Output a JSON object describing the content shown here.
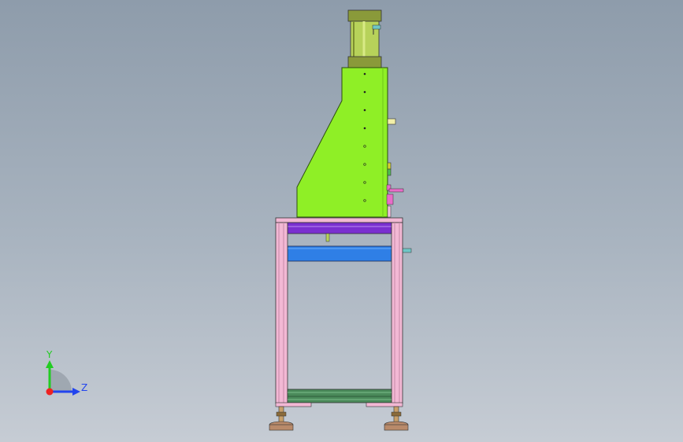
{
  "viewport": {
    "background_top": "#8e9cab",
    "background_bottom": "#c6ccd4"
  },
  "model": {
    "view": "side",
    "colors": {
      "cylinder": "#b7d25a",
      "body": "#8fef26",
      "frame": "#f2b8d4",
      "blue_plate": "#2f7fe6",
      "purple_plate": "#7a2fd0",
      "shelf": "#4a8a5a",
      "feet": "#b98a6a",
      "handle": "#e86cc8"
    }
  },
  "triad": {
    "y_label": "Y",
    "z_label": "Z",
    "y_color": "#22cc22",
    "z_color": "#2244ee",
    "origin_color": "#ee2222"
  }
}
